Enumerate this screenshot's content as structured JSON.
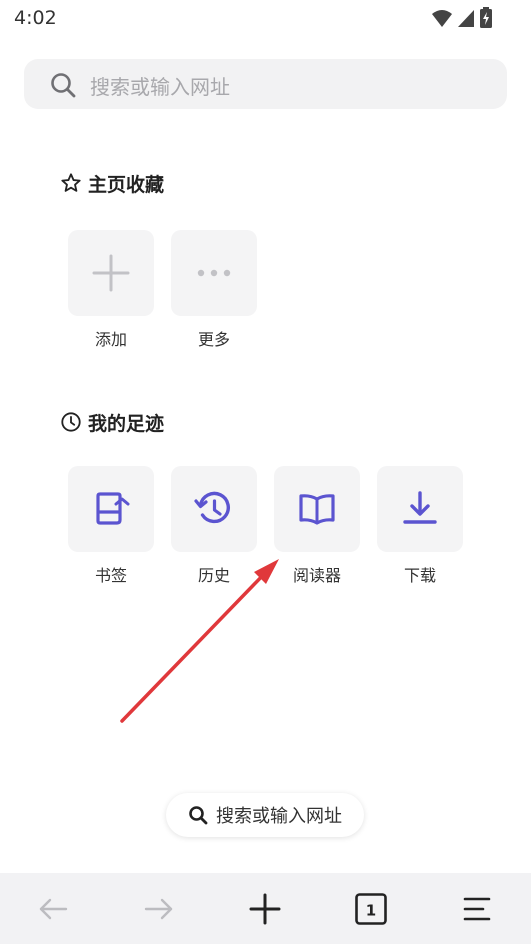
{
  "status_bar": {
    "time": "4:02"
  },
  "search": {
    "placeholder": "搜索或输入网址"
  },
  "favorites": {
    "title": "主页收藏",
    "items": [
      {
        "label": "添加",
        "icon": "plus-icon"
      },
      {
        "label": "更多",
        "icon": "more-dots-icon"
      }
    ]
  },
  "footprints": {
    "title": "我的足迹",
    "items": [
      {
        "label": "书签",
        "icon": "bookmark-icon"
      },
      {
        "label": "历史",
        "icon": "history-icon"
      },
      {
        "label": "阅读器",
        "icon": "reader-icon"
      },
      {
        "label": "下载",
        "icon": "download-icon"
      }
    ]
  },
  "bottom_search": {
    "label": "搜索或输入网址"
  },
  "navbar": {
    "tab_count": "1"
  },
  "colors": {
    "accent": "#5b54d0",
    "tile_bg": "#f4f4f5",
    "annotation": "#e0383b"
  }
}
